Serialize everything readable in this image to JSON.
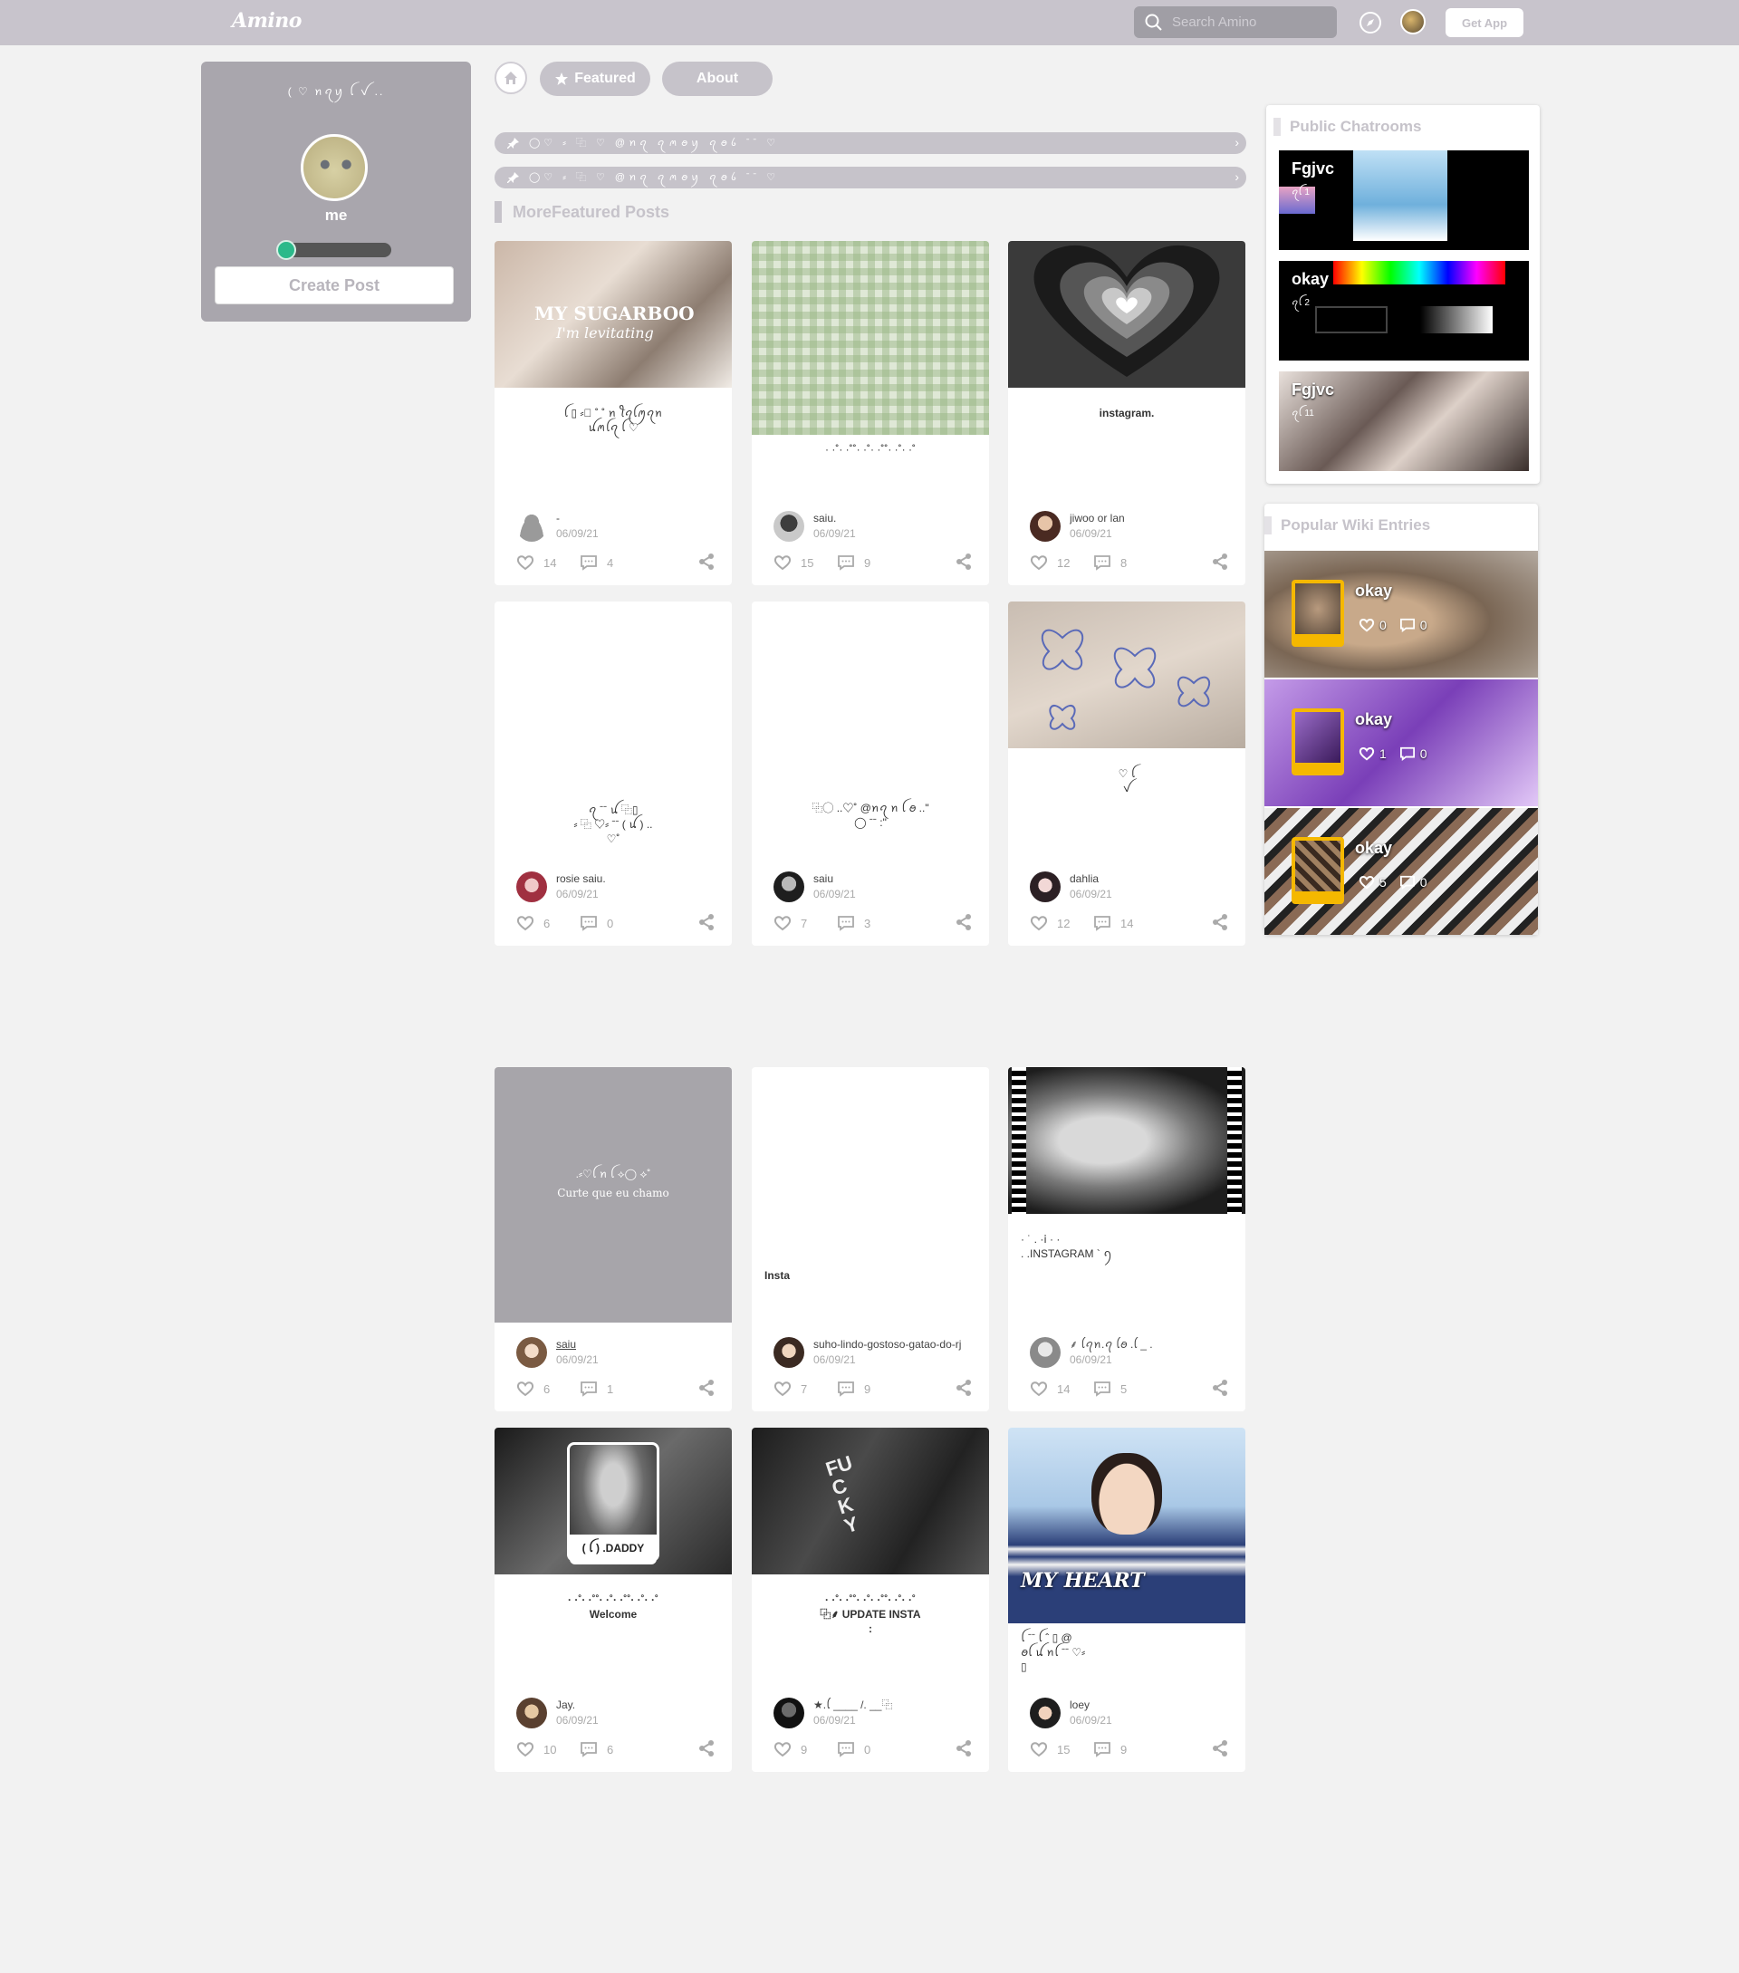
{
  "app": {
    "logo": "Amino"
  },
  "search": {
    "placeholder": "Search Amino"
  },
  "header": {
    "get_app": "Get App"
  },
  "profile": {
    "decoration": "( ♡        ꪀꪖꪗ ꪶ  ꪜ        ..",
    "name": "me",
    "level_progress": 0.1,
    "create_post": "Create Post"
  },
  "nav": {
    "featured": "Featured",
    "about": "About"
  },
  "announcements": [
    {
      "text": "◯♡   ⸗    ⿻    ♡      @ꪀꪖ   ꪖꪔꪮꪗ    ꪖꪮꪉ        ˉˉ                ♡"
    },
    {
      "text": "◯♡   ⸗    ⿻    ♡      @ꪀꪖ   ꪖꪔꪮꪗ    ꪖꪮꪉ        ˉˉ                ♡"
    }
  ],
  "section_title": "MoreFeatured Posts",
  "posts": [
    {
      "caption": "ꪶ     ▯     ⸗᷼ ˚ ˚       ꪀ  ꪻꪖꪶꪑꪖꪀ\nꪊꪔꪶꪖ  ꪶ                 ♡",
      "cover_title": "MY SUGARBOO",
      "cover_sub": "I'm levitating",
      "author": "-",
      "date": "06/09/21",
      "likes": "14",
      "comments": "4"
    },
    {
      "caption": "·   ·˚·   ·˚˚·   ·˚·   ·˚˚·   ·˚·   ·˚",
      "author": "saiu.",
      "date": "06/09/21",
      "likes": "15",
      "comments": "9"
    },
    {
      "caption": "instagram.",
      "author": "jiwoo or lan",
      "date": "06/09/21",
      "likes": "12",
      "comments": "8"
    },
    {
      "caption": "ꪖ     ˉˉ   ꪊ  ⿻▯        \n    ⸗  ⿻  ♡⸗ ˉˉ  ( ꪊ )       ..\n              ♡˚",
      "author": "rosie saiu.",
      "date": "06/09/21",
      "likes": "6",
      "comments": "0"
    },
    {
      "caption": "⿻◯ ..♡˚   @ꪀꪖ    ꪀ  ꪶ  ꪮ ..\"\n                ◯   ˉˉ     :\"",
      "author": "saiu",
      "date": "06/09/21",
      "likes": "7",
      "comments": "3"
    },
    {
      "caption": "♡                             ꪶ\n                    ꪜ",
      "author": "dahlia",
      "date": "06/09/21",
      "likes": "12",
      "comments": "14"
    },
    {
      "caption": ".⸗♡ꪶ ꪀ    ꪶ     ⟡◯    ⟡˚",
      "cover_text": "Curte que eu chamo",
      "author": "saiu",
      "date": "06/09/21",
      "likes": "6",
      "comments": "1"
    },
    {
      "caption": "Insta",
      "author": "suho-lindo-gostoso-gatao-do-rj",
      "date": "06/09/21",
      "likes": "7",
      "comments": "9"
    },
    {
      "caption": "·    ˙   .  ·ⅰ        ·            ·\n           .  .INSTAGRAM ` ꪆ",
      "author": "⸙ ꪶꪖꪀ.ꪖ   ꪶꪮ   .ꪶ          _   .",
      "date": "06/09/21",
      "likes": "14",
      "comments": "5"
    },
    {
      "caption": "·   ·˚·   ·˚˚·   ·˚·   ·˚˚·   ·˚·   ·˚\nWelcome",
      "cover_text": "( ꪶ ) .DADDY",
      "author": "Jay.",
      "date": "06/09/21",
      "likes": "10",
      "comments": "6"
    },
    {
      "caption": "·   ·˚·   ·˚˚·   ·˚·   ·˚˚·   ·˚·   ·˚\n⿻⸙   UPDATE INSTA\n:",
      "cover_text": "FUCK Y",
      "author": "★.ꪶ ____ /.   __⿻",
      "date": "06/09/21",
      "likes": "9",
      "comments": "0"
    },
    {
      "caption": "ꪶ ˉˉ ꪶ          ˆ           ▯         @\n   ꪮꪶ  ꪊ    ꪀꪶ    ˉˉ  ♡⸗\n                              ▯",
      "cover_text": "MY HEART",
      "author": "loey",
      "date": "06/09/21",
      "likes": "15",
      "comments": "9"
    }
  ],
  "sidebar": {
    "chatrooms_title": "Public Chatrooms",
    "chatrooms": [
      {
        "title": "Fgjvc",
        "count": "ꪖꪶ 1"
      },
      {
        "title": "okay",
        "count": "ꪖꪶ 2"
      },
      {
        "title": "Fgjvc",
        "count": "ꪖꪶ 11"
      }
    ],
    "wiki_title": "Popular Wiki Entries",
    "wiki": [
      {
        "name": "okay",
        "likes": "0",
        "comments": "0"
      },
      {
        "name": "okay",
        "likes": "1",
        "comments": "0"
      },
      {
        "name": "okay",
        "likes": "5",
        "comments": "0"
      }
    ]
  }
}
